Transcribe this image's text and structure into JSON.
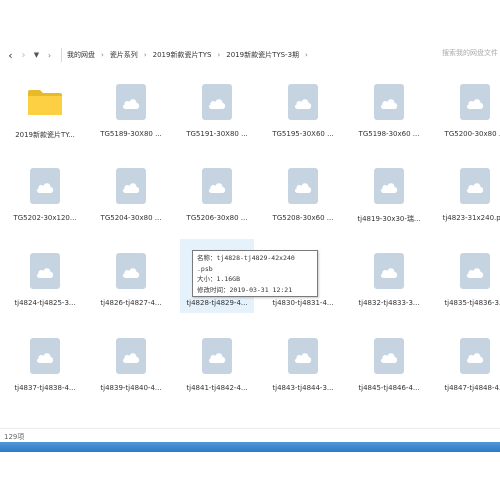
{
  "colors": {
    "accent": "#2f7ac4",
    "thumb": "#c6d4e1",
    "folder": "#fcd042",
    "hover": "#e5f1fb"
  },
  "toolbar": {
    "back_icon": "back-arrow-icon",
    "forward_icon": "forward-arrow-icon",
    "dropdown_icon": "dropdown-caret-icon",
    "chevron_icon": "chevron-right-icon",
    "breadcrumbs": [
      "我的网盘",
      "瓷片系列",
      "2019新款瓷片TYS",
      "2019新款瓷片TYS-3期"
    ],
    "search_placeholder": "搜索我的网盘文件"
  },
  "files": [
    {
      "name": "2019新款瓷片TY...",
      "type": "folder"
    },
    {
      "name": "TG5189-30X80 ...",
      "type": "file"
    },
    {
      "name": "TG5191-30X80 ...",
      "type": "file"
    },
    {
      "name": "TG5195-30X60 ...",
      "type": "file"
    },
    {
      "name": "TG5198-30x60 ...",
      "type": "file"
    },
    {
      "name": "TG5200-30x80 ...",
      "type": "file"
    },
    {
      "name": "TG5202-30x120...",
      "type": "file"
    },
    {
      "name": "TG5204-30x80 ...",
      "type": "file"
    },
    {
      "name": "TG5206-30x80 ...",
      "type": "file"
    },
    {
      "name": "TG5208-30x60 ...",
      "type": "file"
    },
    {
      "name": "tj4819-30x30-瑞...",
      "type": "file"
    },
    {
      "name": "tj4823-31x240.p...",
      "type": "file"
    },
    {
      "name": "tj4824-tj4825-3...",
      "type": "file"
    },
    {
      "name": "tj4826-tj4827-4...",
      "type": "file"
    },
    {
      "name": "tj4828-tj4829-4...",
      "type": "file",
      "hovered": true
    },
    {
      "name": "tj4830-tj4831-4...",
      "type": "file"
    },
    {
      "name": "tj4832-tj4833-3...",
      "type": "file"
    },
    {
      "name": "tj4835-tj4836-3...",
      "type": "file"
    },
    {
      "name": "tj4837-tj4838-4...",
      "type": "file"
    },
    {
      "name": "tj4839-tj4840-4...",
      "type": "file"
    },
    {
      "name": "tj4841-tj4842-4...",
      "type": "file"
    },
    {
      "name": "tj4843-tj4844-3...",
      "type": "file"
    },
    {
      "name": "tj4845-tj4846-4...",
      "type": "file"
    },
    {
      "name": "tj4847-tj4848-4...",
      "type": "file"
    },
    {
      "name": "",
      "type": "file"
    },
    {
      "name": "",
      "type": "file"
    },
    {
      "name": "",
      "type": "file"
    },
    {
      "name": "",
      "type": "file"
    },
    {
      "name": "",
      "type": "file"
    },
    {
      "name": "",
      "type": "file"
    }
  ],
  "tooltip": {
    "line1": "名称：tj4828-tj4829-42x240",
    "line2": ".psb",
    "line3": "大小：1.16GB",
    "line4": "修改时间：2019-03-31 12:21"
  },
  "status": {
    "count_text": "129项"
  }
}
